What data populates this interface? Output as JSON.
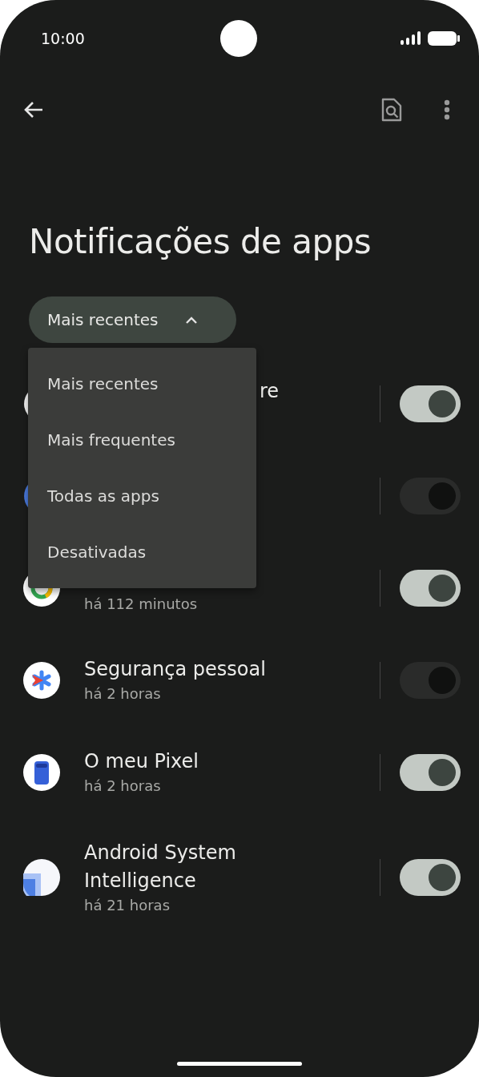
{
  "status_bar": {
    "time": "10:00"
  },
  "title": "Notificações de apps",
  "sort_chip": {
    "label": "Mais recentes",
    "expanded": true
  },
  "sort_menu": [
    "Mais recentes",
    "Mais frequentes",
    "Todas as apps",
    "Desativadas"
  ],
  "apps": [
    {
      "kind": "pale",
      "title_tail": "re",
      "on": true
    },
    {
      "kind": "blue",
      "on": false
    },
    {
      "kind": "ring",
      "subtitle": "há 112 minutos",
      "on": true
    },
    {
      "kind": "safety",
      "title": "Segurança pessoal",
      "subtitle": "há 2 horas",
      "on": false
    },
    {
      "kind": "pixel",
      "title": "O meu Pixel",
      "subtitle": "há 2 horas",
      "on": true
    },
    {
      "kind": "layers",
      "title": "Android System Intelligence",
      "subtitle": "há 21 horas",
      "on": true
    }
  ]
}
